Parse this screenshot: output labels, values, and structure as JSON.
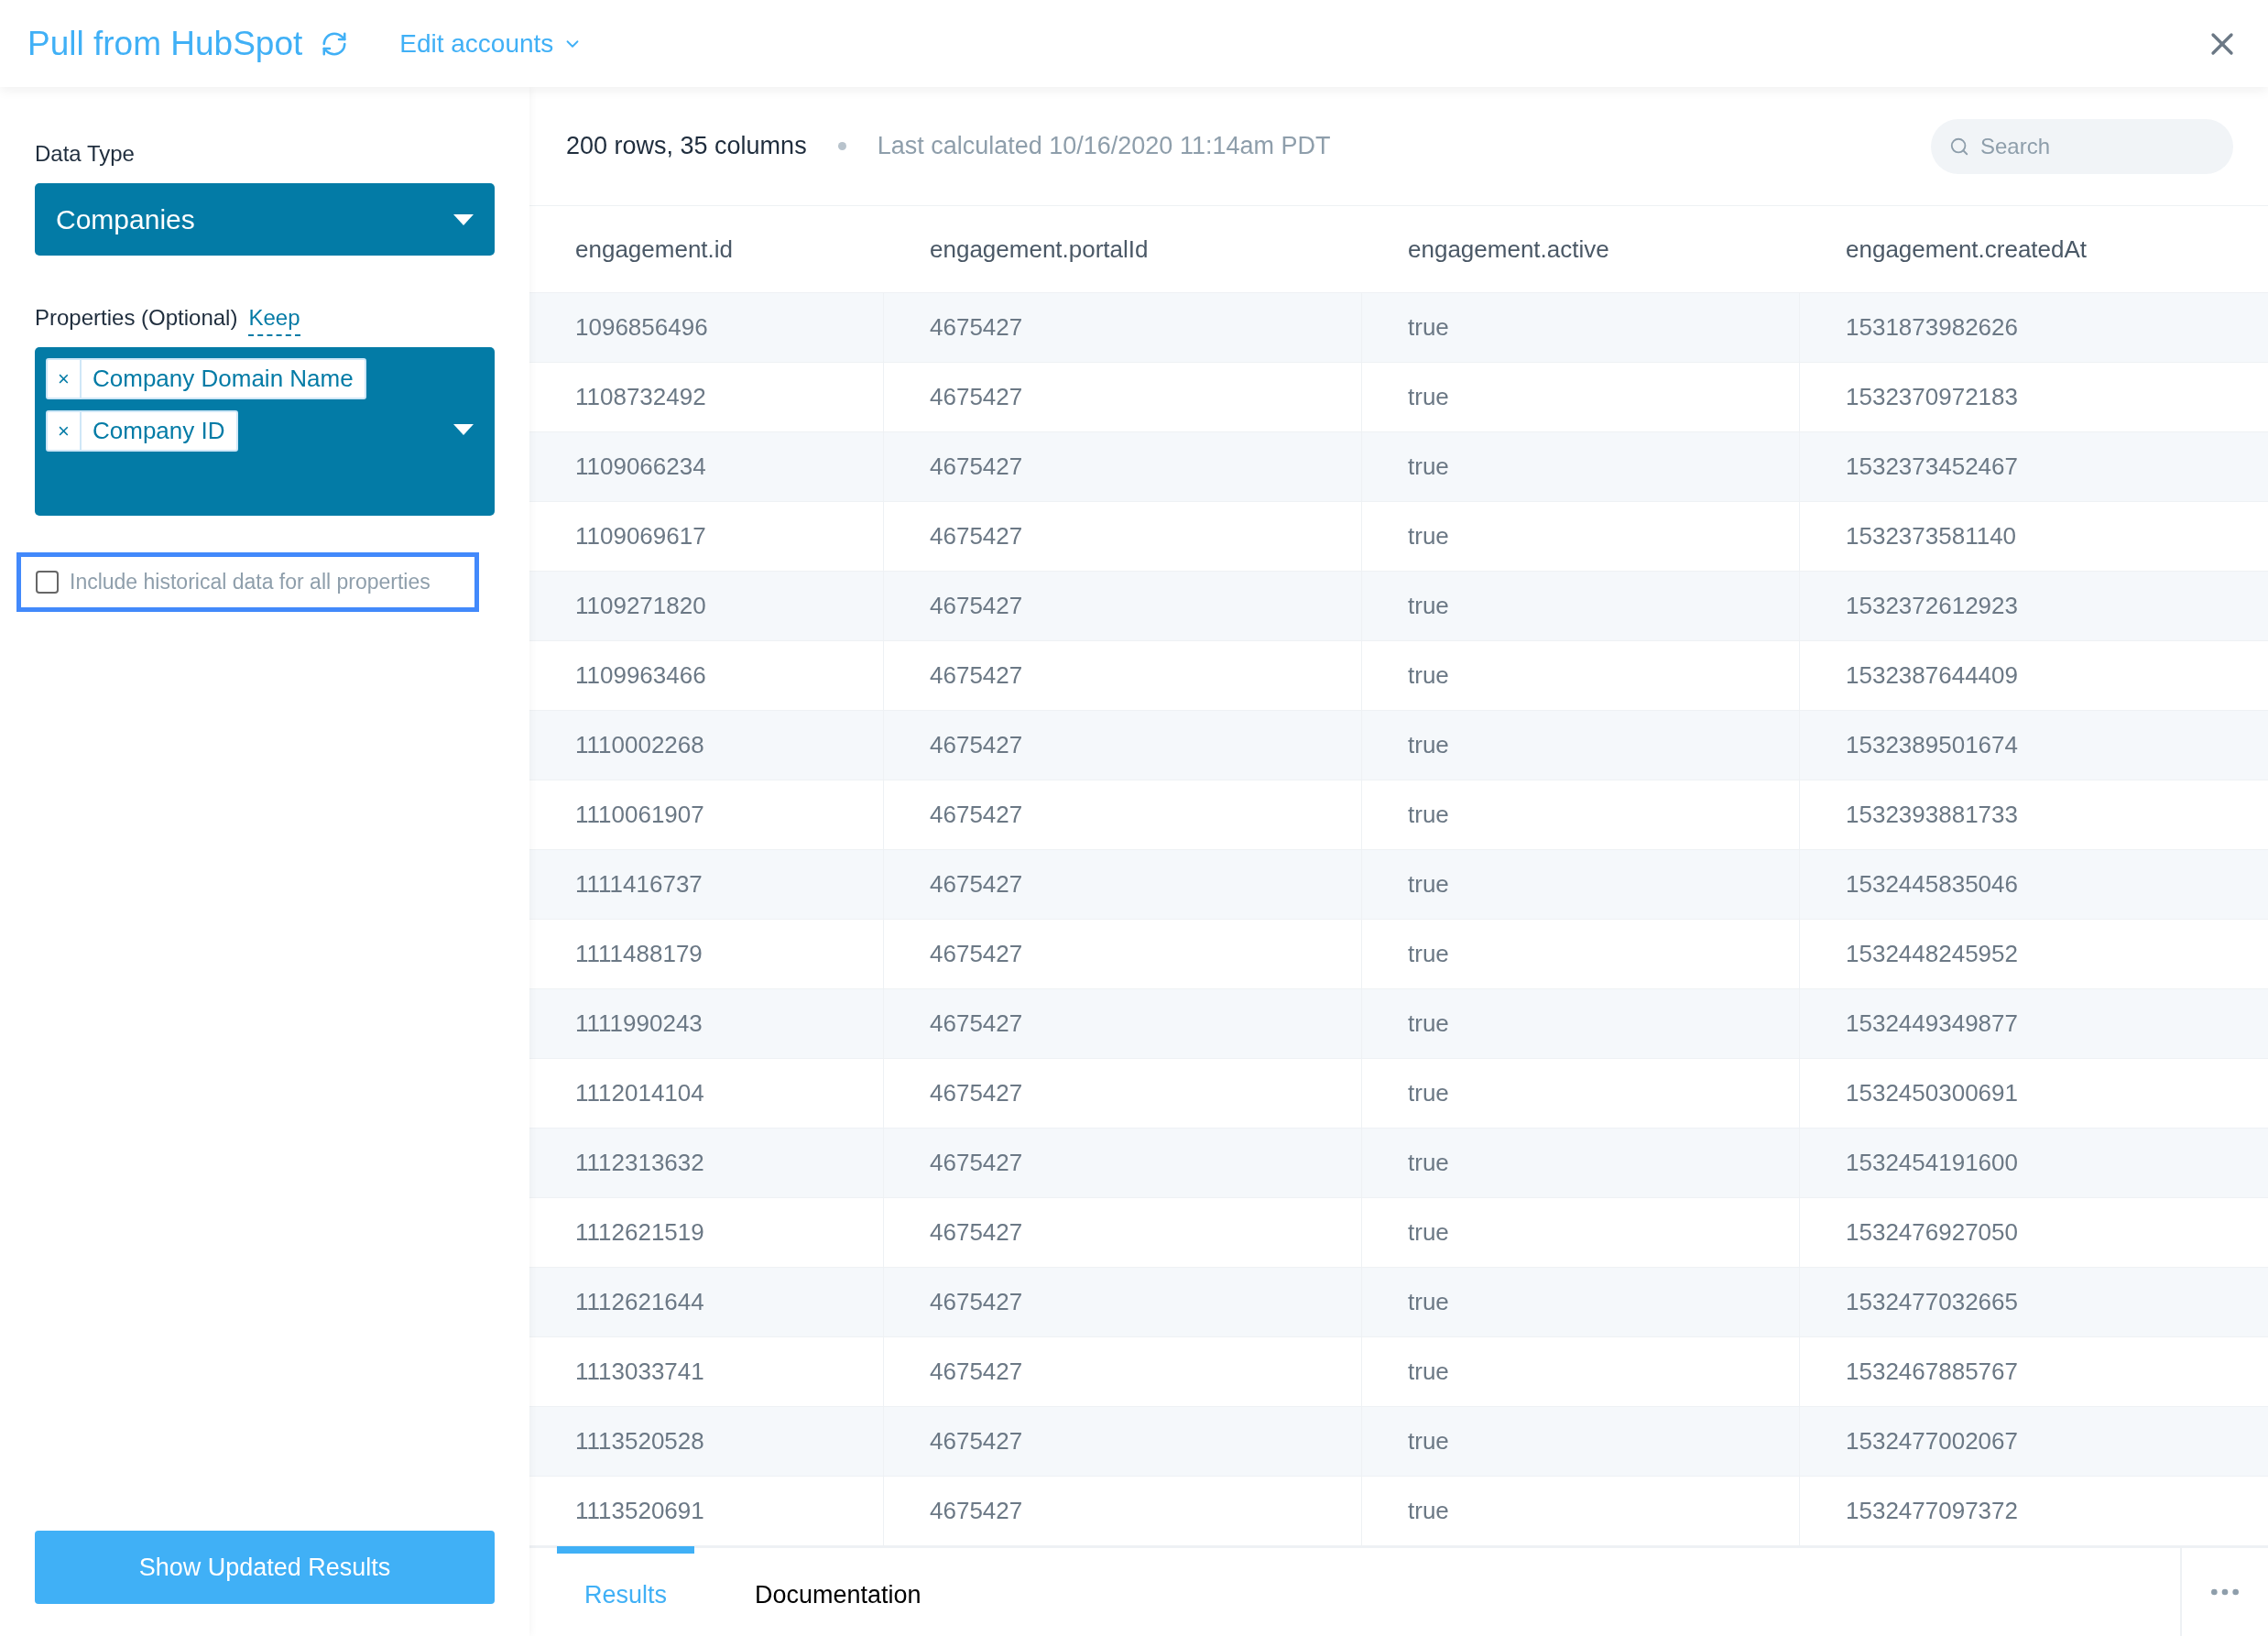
{
  "header": {
    "title": "Pull from HubSpot",
    "accounts_menu": "Edit accounts"
  },
  "sidebar": {
    "data_type_label": "Data Type",
    "data_type_value": "Companies",
    "properties_label": "Properties (Optional)",
    "properties_link": "Keep",
    "properties": [
      "Company Domain Name",
      "Company ID"
    ],
    "remove_glyph": "×",
    "historical_checkbox": {
      "label": "Include historical data for all properties",
      "checked": false
    },
    "submit_button": "Show Updated Results"
  },
  "summary": {
    "counts": "200 rows, 35 columns",
    "last_calculated": "Last calculated 10/16/2020 11:14am PDT",
    "search_placeholder": "Search"
  },
  "table": {
    "columns": [
      "engagement.id",
      "engagement.portalId",
      "engagement.active",
      "engagement.createdAt"
    ],
    "rows": [
      [
        "1096856496",
        "4675427",
        "true",
        "1531873982626"
      ],
      [
        "1108732492",
        "4675427",
        "true",
        "1532370972183"
      ],
      [
        "1109066234",
        "4675427",
        "true",
        "1532373452467"
      ],
      [
        "1109069617",
        "4675427",
        "true",
        "1532373581140"
      ],
      [
        "1109271820",
        "4675427",
        "true",
        "1532372612923"
      ],
      [
        "1109963466",
        "4675427",
        "true",
        "1532387644409"
      ],
      [
        "1110002268",
        "4675427",
        "true",
        "1532389501674"
      ],
      [
        "1110061907",
        "4675427",
        "true",
        "1532393881733"
      ],
      [
        "1111416737",
        "4675427",
        "true",
        "1532445835046"
      ],
      [
        "1111488179",
        "4675427",
        "true",
        "1532448245952"
      ],
      [
        "1111990243",
        "4675427",
        "true",
        "1532449349877"
      ],
      [
        "1112014104",
        "4675427",
        "true",
        "1532450300691"
      ],
      [
        "1112313632",
        "4675427",
        "true",
        "1532454191600"
      ],
      [
        "1112621519",
        "4675427",
        "true",
        "1532476927050"
      ],
      [
        "1112621644",
        "4675427",
        "true",
        "1532477032665"
      ],
      [
        "1113033741",
        "4675427",
        "true",
        "1532467885767"
      ],
      [
        "1113520528",
        "4675427",
        "true",
        "1532477002067"
      ],
      [
        "1113520691",
        "4675427",
        "true",
        "1532477097372"
      ]
    ]
  },
  "bottom_tabs": [
    {
      "label": "Results",
      "selected": true
    },
    {
      "label": "Documentation",
      "selected": false
    }
  ]
}
